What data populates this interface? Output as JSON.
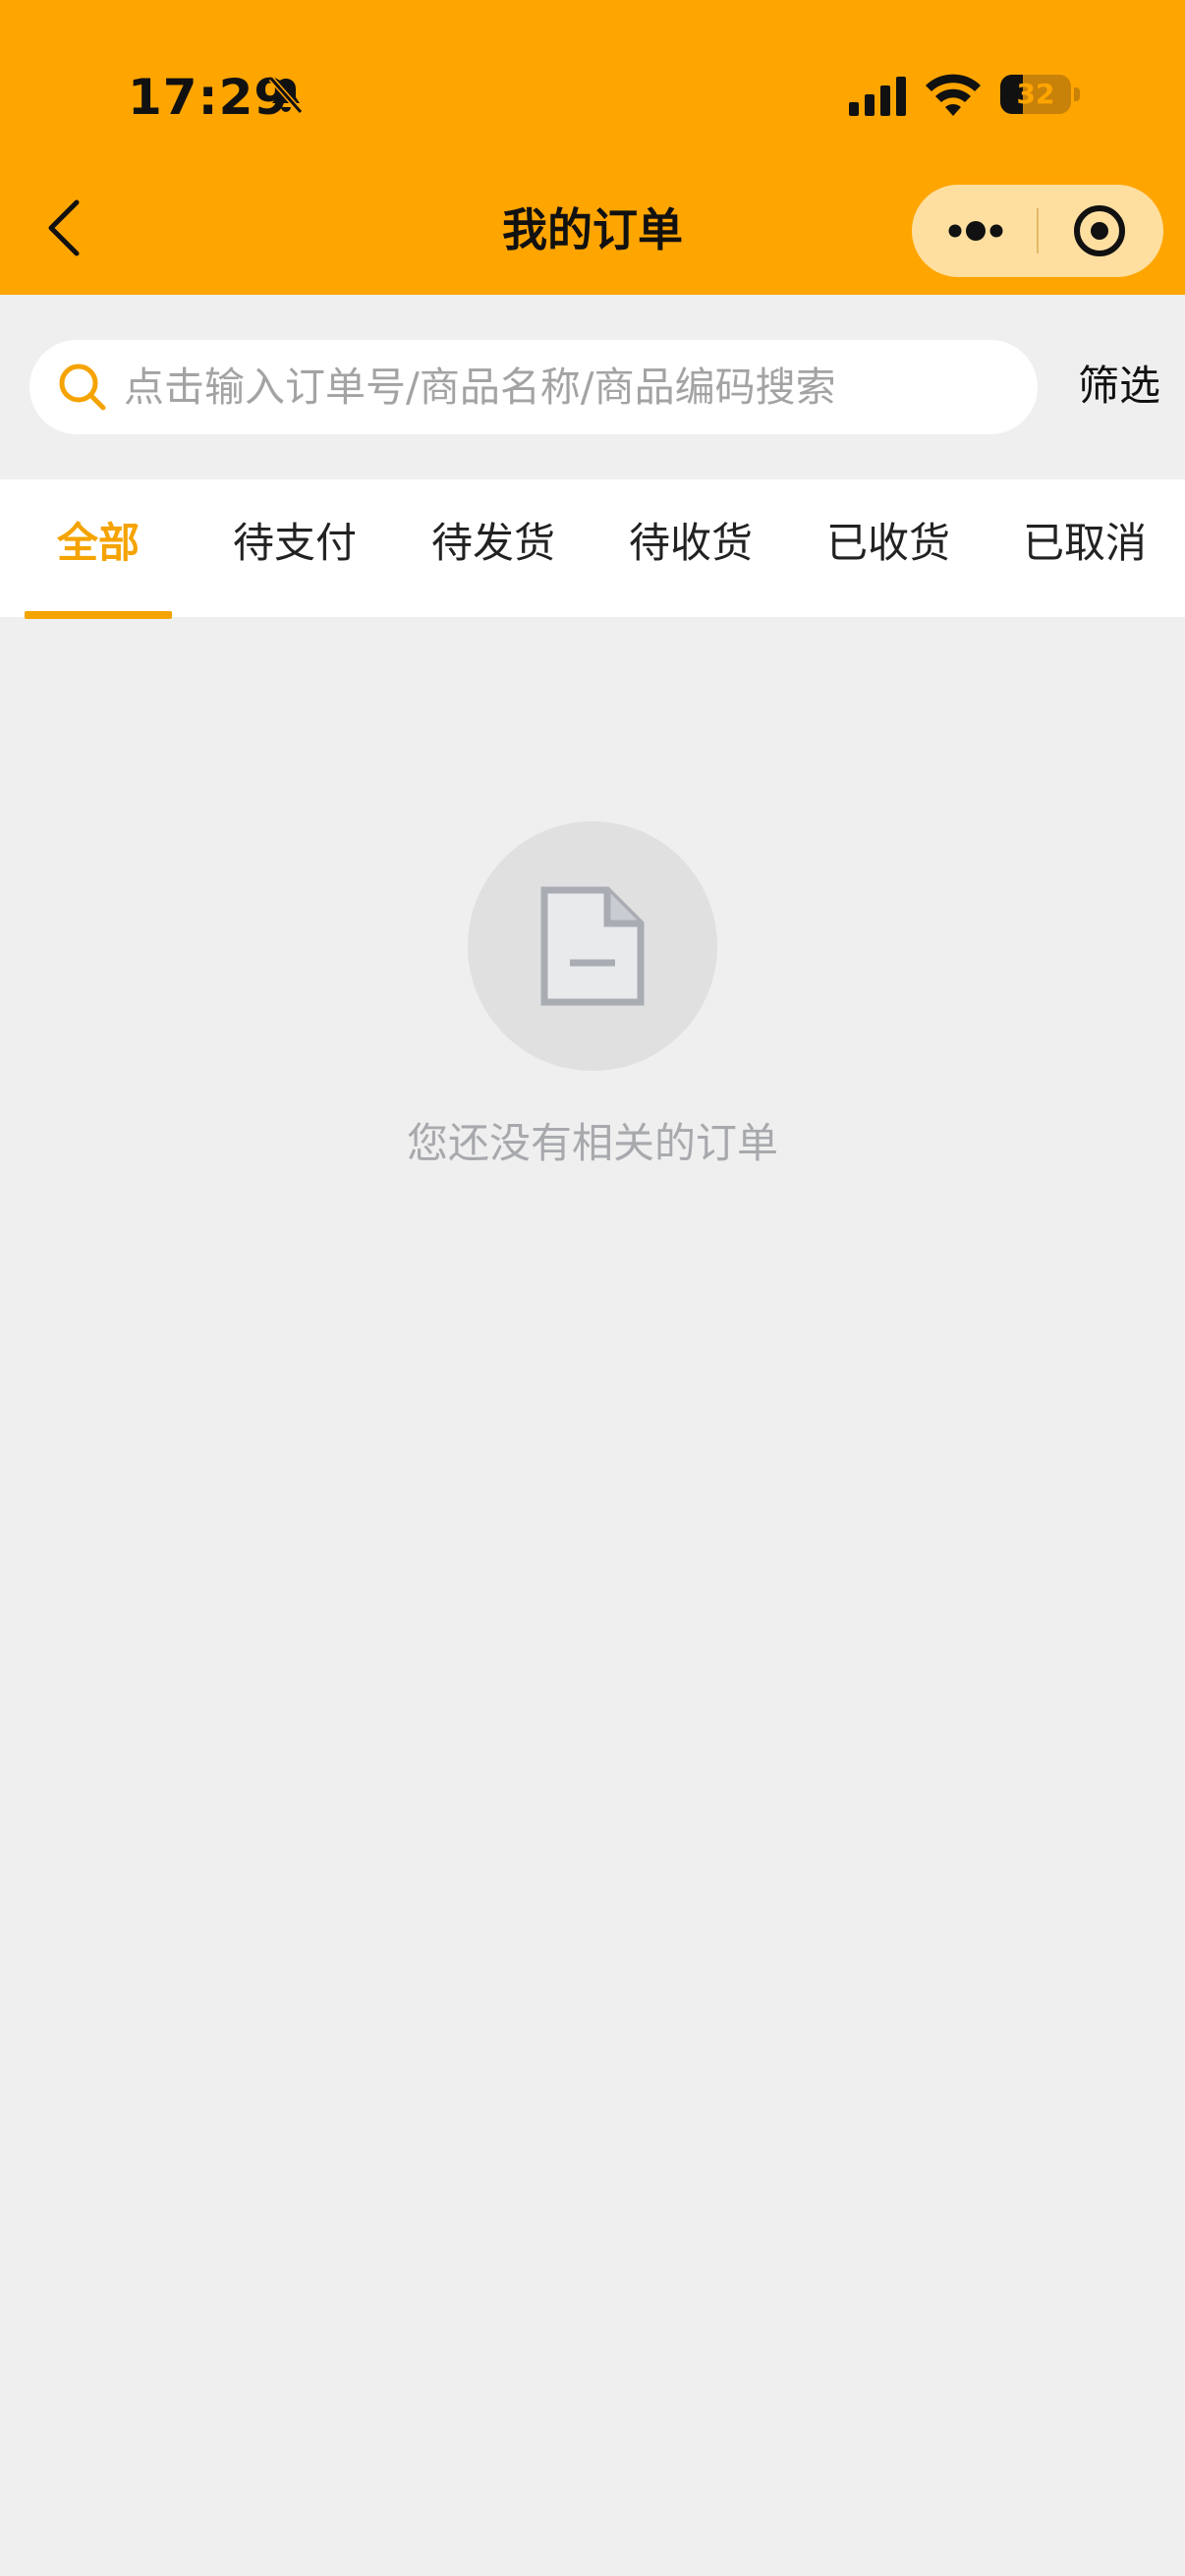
{
  "status_bar": {
    "time": "17:29",
    "battery": "32",
    "battery_level": 0.32
  },
  "nav": {
    "title": "我的订单",
    "back_icon": "chevron-left-icon",
    "more_icon": "more-dots-icon",
    "close_icon": "target-circle-icon"
  },
  "search": {
    "placeholder": "点击输入订单号/商品名称/商品编码搜索",
    "filter_label": "筛选"
  },
  "tabs": [
    {
      "label": "全部",
      "active": true
    },
    {
      "label": "待支付",
      "active": false
    },
    {
      "label": "待发货",
      "active": false
    },
    {
      "label": "待收货",
      "active": false
    },
    {
      "label": "已收货",
      "active": false
    },
    {
      "label": "已取消",
      "active": false
    }
  ],
  "empty_state": {
    "icon": "document-icon",
    "message": "您还没有相关的订单"
  },
  "colors": {
    "header": "#ffa500",
    "accent": "#f5a300",
    "background": "#efefef"
  }
}
